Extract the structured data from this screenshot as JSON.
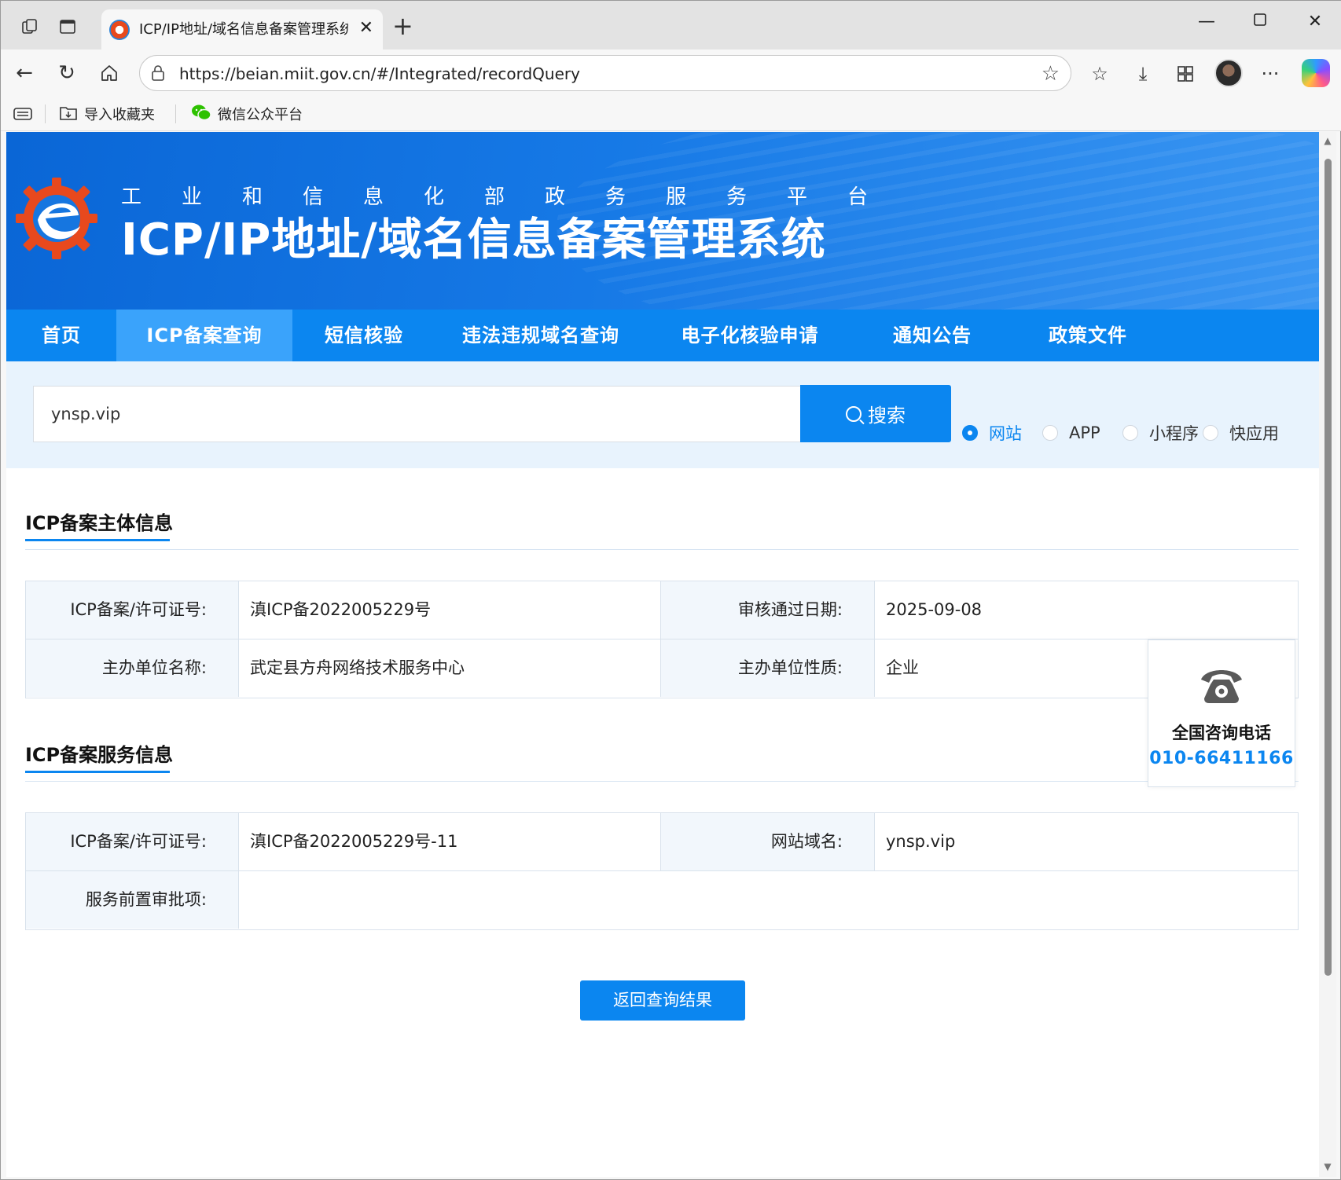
{
  "browser": {
    "tab_title": "ICP/IP地址/域名信息备案管理系统",
    "url": "https://beian.miit.gov.cn/#/Integrated/recordQuery",
    "favorites": [
      {
        "label": "导入收藏夹",
        "icon": "import-favorites-icon"
      },
      {
        "label": "微信公众平台",
        "icon": "wechat-icon"
      }
    ],
    "colors": {
      "tabbar": "#e3e3e3",
      "toolbar": "#f7f7f7"
    }
  },
  "banner": {
    "subtitle": "工业和信息化部政务服务平台",
    "title": "ICP/IP地址/域名信息备案管理系统"
  },
  "nav": {
    "items": [
      {
        "label": "首页"
      },
      {
        "label": "ICP备案查询"
      },
      {
        "label": "短信核验"
      },
      {
        "label": "违法违规域名查询"
      },
      {
        "label": "电子化核验申请"
      },
      {
        "label": "通知公告"
      },
      {
        "label": "政策文件"
      }
    ],
    "active": "ICP备案查询"
  },
  "search": {
    "value": "ynsp.vip",
    "button_label": "搜索",
    "types": [
      {
        "label": "网站",
        "checked": true
      },
      {
        "label": "APP",
        "checked": false
      },
      {
        "label": "小程序",
        "checked": false
      },
      {
        "label": "快应用",
        "checked": false
      }
    ]
  },
  "subject_info": {
    "title": "ICP备案主体信息",
    "rows": [
      {
        "label1": "ICP备案/许可证号:",
        "value1": "滇ICP备2022005229号",
        "label2": "审核通过日期:",
        "value2": "2025-09-08"
      },
      {
        "label1": "主办单位名称:",
        "value1": "武定县方舟网络技术服务中心",
        "label2": "主办单位性质:",
        "value2": "企业"
      }
    ]
  },
  "service_info": {
    "title": "ICP备案服务信息",
    "rows": [
      {
        "label1": "ICP备案/许可证号:",
        "value1": "滇ICP备2022005229号-11",
        "label2": "网站域名:",
        "value2": "ynsp.vip"
      },
      {
        "label1": "服务前置审批项:",
        "value1": ""
      }
    ]
  },
  "hotline": {
    "label": "全国咨询电话",
    "number": "010-66411166",
    "icon": "telephone-icon"
  },
  "back_button": "返回查询结果",
  "colors": {
    "primary": "#0b86f0",
    "nav_active": "#3aa3fb",
    "label_bg": "#f2f7fc",
    "search_band": "#e8f3fd"
  }
}
